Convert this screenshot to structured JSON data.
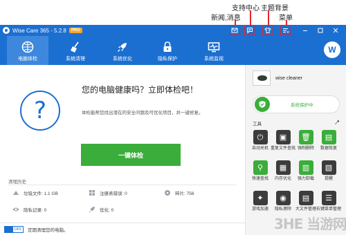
{
  "annotations": {
    "news": "新闻,消息",
    "support": "支持中心",
    "theme": "主题背景",
    "menu": "菜单"
  },
  "titlebar": {
    "title": "Wise Care 365 - 5.2.8",
    "badge": "PRO"
  },
  "nav": {
    "items": [
      {
        "label": "电脑体检",
        "icon": "globe-scan-icon"
      },
      {
        "label": "系统清理",
        "icon": "broom-icon"
      },
      {
        "label": "系统优化",
        "icon": "rocket-icon"
      },
      {
        "label": "隐私保护",
        "icon": "lock-icon"
      },
      {
        "label": "系统监视",
        "icon": "monitor-icon"
      }
    ],
    "avatar": "W"
  },
  "main": {
    "question": "?",
    "headline": "您的电脑健康吗？立即体检吧！",
    "subtext": "体检能帮您找出潜在的安全问题及可优化项目，并一键修复。",
    "check_button": "一键体检",
    "history_title": "清理历史",
    "stats": [
      {
        "label": "垃圾文件: 1.1 GB",
        "icon": "trash-files-icon"
      },
      {
        "label": "注册表错误: 0",
        "icon": "registry-icon"
      },
      {
        "label": "碎片: 756",
        "icon": "fragment-icon"
      },
      {
        "label": "隐私记录: 0",
        "icon": "privacy-icon"
      },
      {
        "label": "优化: 0",
        "icon": "optimize-icon"
      }
    ]
  },
  "status": {
    "toggle": "OFF",
    "text": "定期清理您的电脑。"
  },
  "right": {
    "profile_name": "wise cleaner",
    "protect_label": "系统保护中",
    "tools_title": "工具",
    "tools": [
      {
        "label": "自动关机",
        "icon": "power-icon"
      },
      {
        "label": "重复文件查找",
        "icon": "duplicate-file-icon"
      },
      {
        "label": "强制删除",
        "icon": "force-delete-icon"
      },
      {
        "label": "数据恢复",
        "icon": "data-recovery-icon"
      },
      {
        "label": "快速查找",
        "icon": "search-icon"
      },
      {
        "label": "内存优化",
        "icon": "memory-icon"
      },
      {
        "label": "强力卸载",
        "icon": "uninstall-icon"
      },
      {
        "label": "提醒",
        "icon": "reminder-icon"
      },
      {
        "label": "游戏加速",
        "icon": "game-icon"
      },
      {
        "label": "隐私擦除",
        "icon": "eraser-icon"
      },
      {
        "label": "大文件管理",
        "icon": "large-file-icon"
      },
      {
        "label": "右键菜单管理",
        "icon": "context-menu-icon"
      }
    ]
  },
  "watermark": "3HE 当游网",
  "colors": {
    "brand_blue": "#1b6fd1",
    "nav_active": "#3d88dd",
    "action_green": "#3aad3a",
    "annotation_red": "#e0262c"
  }
}
